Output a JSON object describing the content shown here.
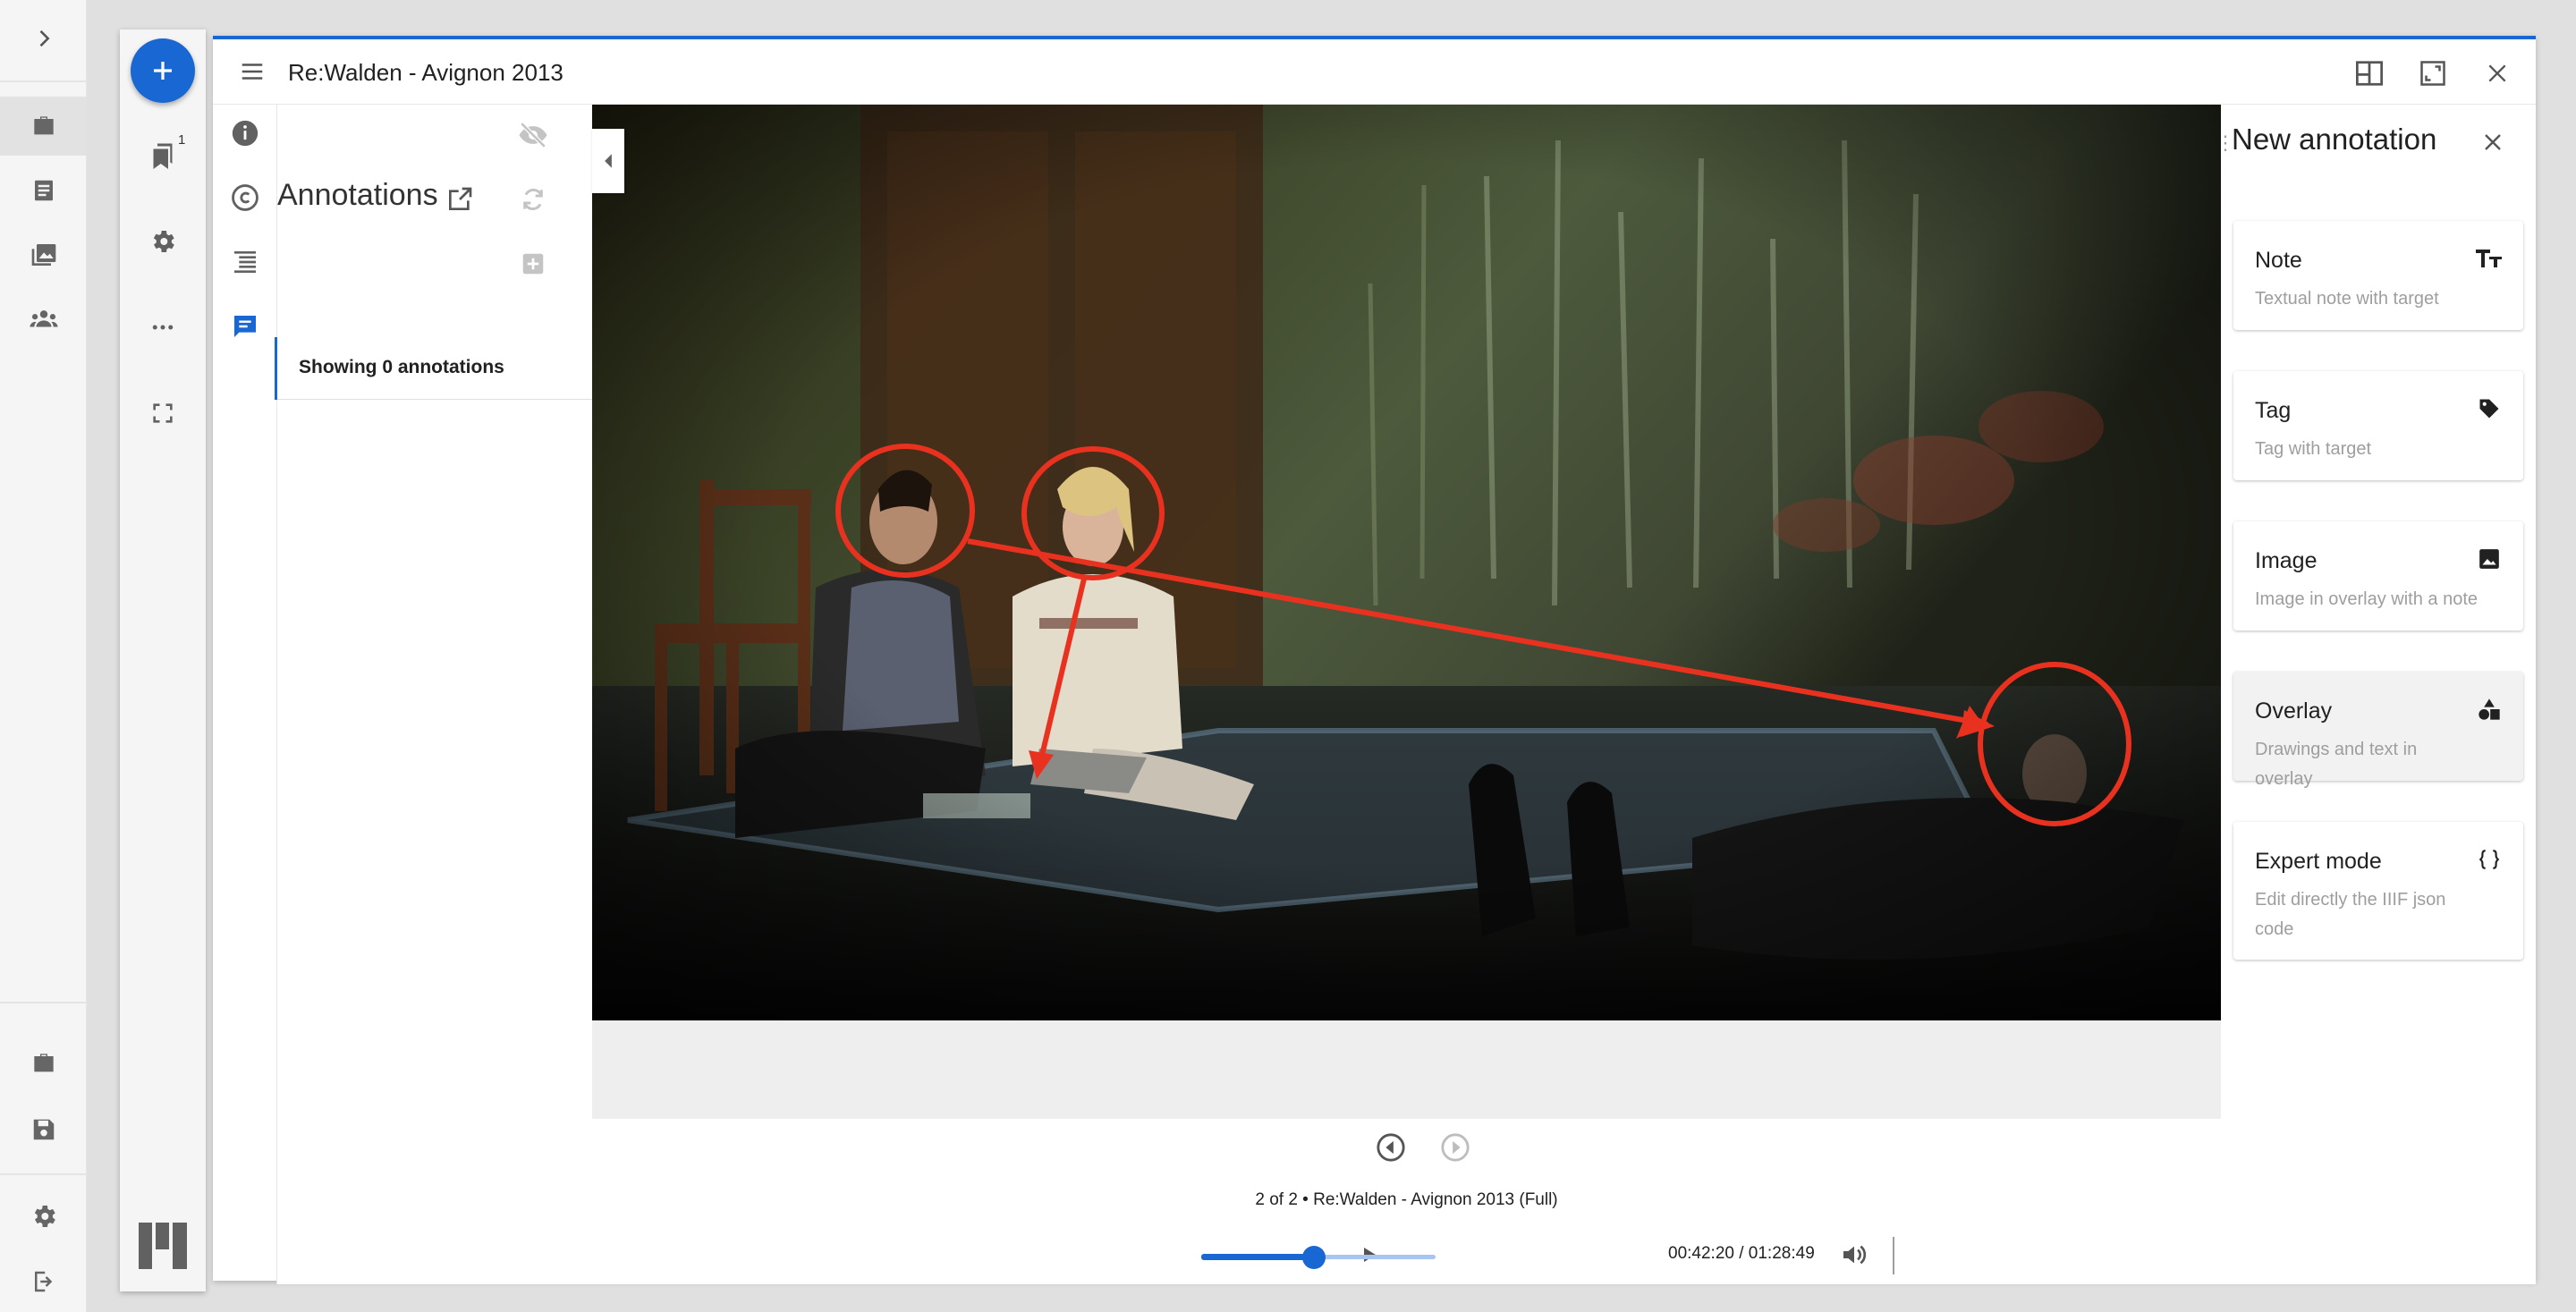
{
  "window": {
    "title": "Re:Walden - Avignon 2013"
  },
  "rail": {
    "bookmark_badge": "1"
  },
  "annotations_panel": {
    "heading": "Annotations",
    "showing": "Showing 0 annotations"
  },
  "player": {
    "caption": "2 of 2 • Re:Walden - Avignon 2013 (Full)",
    "time": "00:42:20 / 01:28:49",
    "progress_fraction": 0.48
  },
  "new_annotation": {
    "title": "New annotation",
    "cards": [
      {
        "title": "Note",
        "desc": "Textual note with target",
        "icon": "text-fields-icon"
      },
      {
        "title": "Tag",
        "desc": "Tag with target",
        "icon": "tag-icon"
      },
      {
        "title": "Image",
        "desc": "Image in overlay with a note",
        "icon": "image-icon"
      },
      {
        "title": "Overlay",
        "desc": "Drawings and text in overlay",
        "icon": "shapes-icon"
      },
      {
        "title": "Expert mode",
        "desc": "Edit directly the IIIF json code",
        "icon": "braces-icon"
      }
    ]
  },
  "colors": {
    "accent": "#1967d2",
    "annotation_shape": "#e8321f"
  }
}
